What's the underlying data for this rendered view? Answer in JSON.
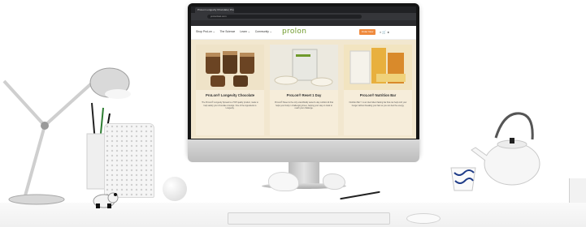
{
  "browser": {
    "tab_title": "ProLon Longevity Chocolate | ProLon®",
    "url": "prolonfast.com"
  },
  "site": {
    "nav": [
      "Shop ProLon ⌄",
      "The Science",
      "Learn ⌄",
      "Community ⌄"
    ],
    "logo": "prolon",
    "order_label": "Order Now"
  },
  "products": [
    {
      "title": "ProLon® Longevity Chocolate",
      "description": "The ProLon® Longevity Spread is a TOP quality product, made to help satisfy your chocolate cravings. One of the ingredients is Longevity."
    },
    {
      "title": "ProLon® Reset 1 Day",
      "description": "ProLon® Reset is the only scientifically tested 1-day nutrition kit that helps your body in challenging times, helping your stay on track to reach your challenge."
    },
    {
      "title": "ProLon® Nutrition Bar",
      "description": "Nutrition Bar™ is an intermittent fasting bar that can help curb your hunger without breaking your fast so you can feel the energy."
    }
  ],
  "colors": {
    "accent_orange": "#ef8a3d",
    "brand_green": "#6f9a2b",
    "product_bg": "#f2e7cf"
  }
}
